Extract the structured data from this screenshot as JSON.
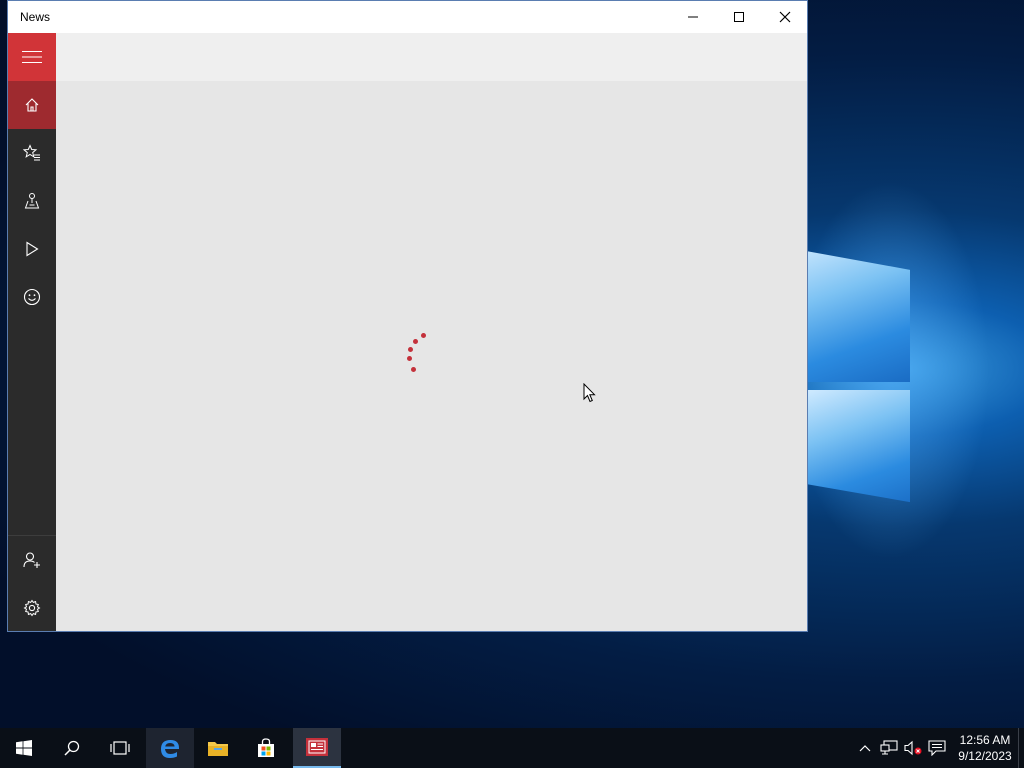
{
  "window": {
    "title": "News",
    "caption_buttons": [
      "minimize",
      "maximize",
      "close"
    ]
  },
  "nav": {
    "items": [
      {
        "icon": "hamburger-icon",
        "selected": false
      },
      {
        "icon": "home-icon",
        "selected": true
      },
      {
        "icon": "favorites-icon",
        "selected": false
      },
      {
        "icon": "local-icon",
        "selected": false
      },
      {
        "icon": "video-icon",
        "selected": false
      },
      {
        "icon": "smiley-icon",
        "selected": false
      },
      {
        "icon": "add-account-icon",
        "selected": false
      },
      {
        "icon": "settings-icon",
        "selected": false
      }
    ]
  },
  "content": {
    "state": "loading",
    "spinner_color": "#c4313b"
  },
  "colors": {
    "accent": "#d13438",
    "accent_dark": "#9e2a2f",
    "nav_bg": "#2b2b2b",
    "content_bg": "#e6e6e6"
  },
  "taskbar": {
    "items": [
      {
        "icon": "start-icon"
      },
      {
        "icon": "search-icon"
      },
      {
        "icon": "task-view-icon"
      },
      {
        "icon": "edge-icon"
      },
      {
        "icon": "file-explorer-icon"
      },
      {
        "icon": "store-icon"
      },
      {
        "icon": "news-icon",
        "active": true
      }
    ],
    "tray": [
      "chevron-up-icon",
      "network-icon",
      "volume-muted-icon",
      "notifications-icon"
    ],
    "clock": {
      "time": "12:56 AM",
      "date": "9/12/2023"
    }
  }
}
